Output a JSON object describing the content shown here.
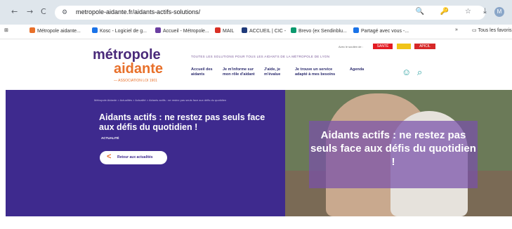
{
  "browser": {
    "nav": {
      "back": "←",
      "forward": "→",
      "reload": "C"
    },
    "url": "metropole-aidante.fr/aidants-actifs-solutions/",
    "site_info_icon": "tune-icon",
    "url_icons": "🔍 🔑 ☆",
    "download_icon": "⤓",
    "profile_initial": "M",
    "bookmarks": [
      {
        "label": "Métropole aidante...",
        "color": "#e8702a"
      },
      {
        "label": "Kosc - Logiciel de g...",
        "color": "#1a73e8"
      },
      {
        "label": "Accueil - Métropole...",
        "color": "#6a3ea1"
      },
      {
        "label": "MAIL",
        "color": "#d93025"
      },
      {
        "label": "ACCUEIL | CIC -",
        "color": "#1f3a7a"
      },
      {
        "label": "Brevo (ex Sendinblu...",
        "color": "#0b996e"
      },
      {
        "label": "Partagé avec vous -...",
        "color": "#1a73e8"
      }
    ],
    "bookmarks_overflow": "»",
    "all_bookmarks": "Tous les favoris"
  },
  "site": {
    "logo_line1": "métropole",
    "logo_line2": "aidante",
    "logo_sub": "— ASSOCIATION LOI 1901",
    "tagline": "TOUTES LES SOLUTIONS POUR TOUS LES AIDANTS DE LA MÉTROPOLE DE LYON",
    "partners_label": "Avec le soutien de :",
    "partner_logos": [
      {
        "label": "SANTÉ",
        "color": "#e31b23"
      },
      {
        "label": "",
        "color": "#f0c419"
      },
      {
        "label": "APICIL",
        "color": "#d62828"
      }
    ],
    "menu": [
      "Accueil des aidants",
      "Je m'informe sur mon rôle d'aidant",
      "J'aide, je m'évalue",
      "Je trouve un service adapté à mes besoins",
      "Agenda"
    ],
    "account_icon": "☺",
    "search_icon": "⌕"
  },
  "hero": {
    "breadcrumb": "Métropole Aidante > Actualités > Actualité > Aidants actifs : ne restez pas seuls face aux défis du quotidien",
    "title": "Aidants actifs : ne restez pas seuls face aux défis du quotidien !",
    "tag": "ACTUALITÉ",
    "back_label": "Retour aux actualités",
    "back_arrow": "<",
    "image_caption": "Aidants actifs : ne restez pas seuls face aux défis du quotidien !",
    "side_tab_icon": "💬"
  },
  "colors": {
    "purple": "#3e2a8e",
    "orange": "#e8702a",
    "teal": "#2aa0a0"
  }
}
